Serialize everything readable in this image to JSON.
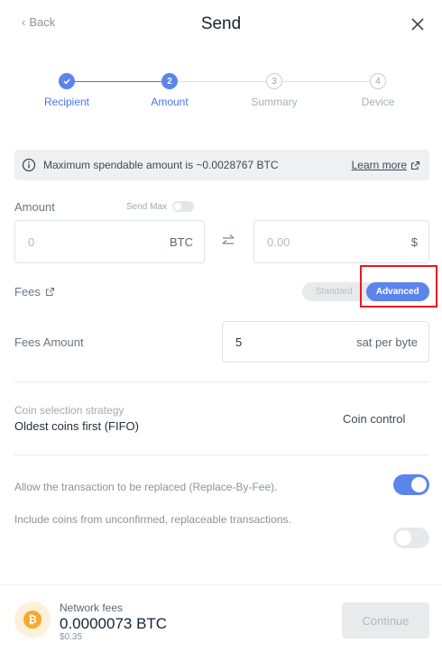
{
  "header": {
    "back_label": "Back",
    "title": "Send"
  },
  "stepper": {
    "steps": [
      {
        "number": "",
        "label": "Recipient",
        "state": "done"
      },
      {
        "number": "2",
        "label": "Amount",
        "state": "active"
      },
      {
        "number": "3",
        "label": "Summary",
        "state": "todo"
      },
      {
        "number": "4",
        "label": "Device",
        "state": "todo"
      }
    ]
  },
  "banner": {
    "message": "Maximum spendable amount is ~0.0028767 BTC",
    "link_label": "Learn more"
  },
  "amount": {
    "label": "Amount",
    "send_max_label": "Send Max",
    "send_max_enabled": false,
    "crypto_placeholder": "0",
    "crypto_unit": "BTC",
    "fiat_placeholder": "0.00",
    "fiat_unit": "$"
  },
  "fees": {
    "label": "Fees",
    "modes": [
      "Standard",
      "Advanced"
    ],
    "selected_mode": "Advanced",
    "amount_label": "Fees Amount",
    "amount_value": "5",
    "amount_unit": "sat per byte"
  },
  "coin_selection": {
    "title": "Coin selection strategy",
    "value": "Oldest coins first (FIFO)",
    "control_label": "Coin control"
  },
  "options": [
    {
      "label": "Allow the transaction to be replaced (Replace-By-Fee).",
      "enabled": true
    },
    {
      "label": "Include coins from unconfirmed, replaceable transactions.",
      "enabled": false
    }
  ],
  "footer": {
    "network_fees_label": "Network fees",
    "network_fees_value": "0.0000073 BTC",
    "network_fees_fiat": "$0.35",
    "continue_label": "Continue",
    "coin_symbol": "₿"
  },
  "colors": {
    "accent": "#5c85eb",
    "highlight_box": "#e8191c",
    "bitcoin": "#f7a928"
  }
}
